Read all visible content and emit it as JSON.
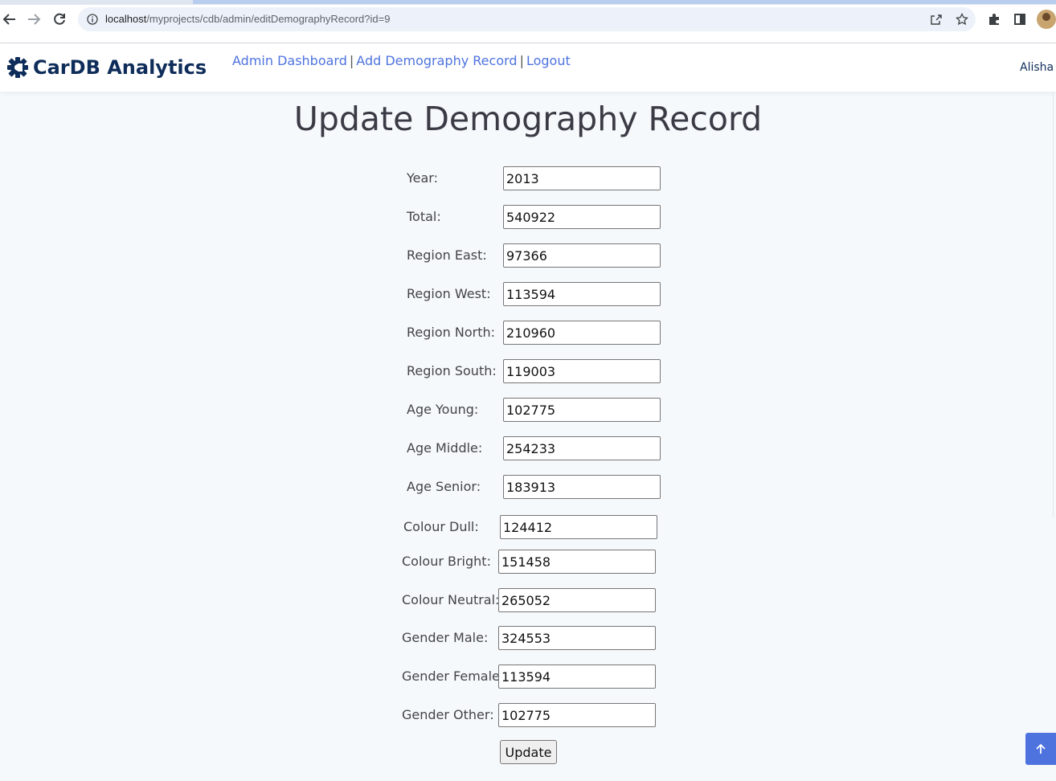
{
  "browser": {
    "url_host": "localhost",
    "url_path": "/myprojects/cdb/admin/editDemographyRecord?id=9"
  },
  "header": {
    "brand": "CarDB Analytics",
    "menu": [
      {
        "label": "Admin Dashboard"
      },
      {
        "label": "Add Demography Record"
      },
      {
        "label": "Logout"
      }
    ],
    "separator": "|",
    "user": "Alisha"
  },
  "page": {
    "title": "Update Demography Record"
  },
  "form": {
    "fields": [
      {
        "label": "Year:",
        "value": "2013"
      },
      {
        "label": "Total:",
        "value": "540922"
      },
      {
        "label": "Region East:",
        "value": "97366"
      },
      {
        "label": "Region West:",
        "value": "113594"
      },
      {
        "label": "Region North:",
        "value": "210960"
      },
      {
        "label": "Region South:",
        "value": "119003"
      },
      {
        "label": "Age Young:",
        "value": "102775"
      },
      {
        "label": "Age Middle:",
        "value": "254233"
      },
      {
        "label": "Age Senior:",
        "value": "183913"
      },
      {
        "label": "Colour Dull:",
        "value": "124412"
      },
      {
        "label": "Colour Bright:",
        "value": "151458"
      },
      {
        "label": "Colour Neutral:",
        "value": "265052"
      },
      {
        "label": "Gender Male:",
        "value": "324553"
      },
      {
        "label": "Gender Female:",
        "value": "113594"
      },
      {
        "label": "Gender Other:",
        "value": "102775"
      }
    ],
    "submit_label": "Update"
  }
}
